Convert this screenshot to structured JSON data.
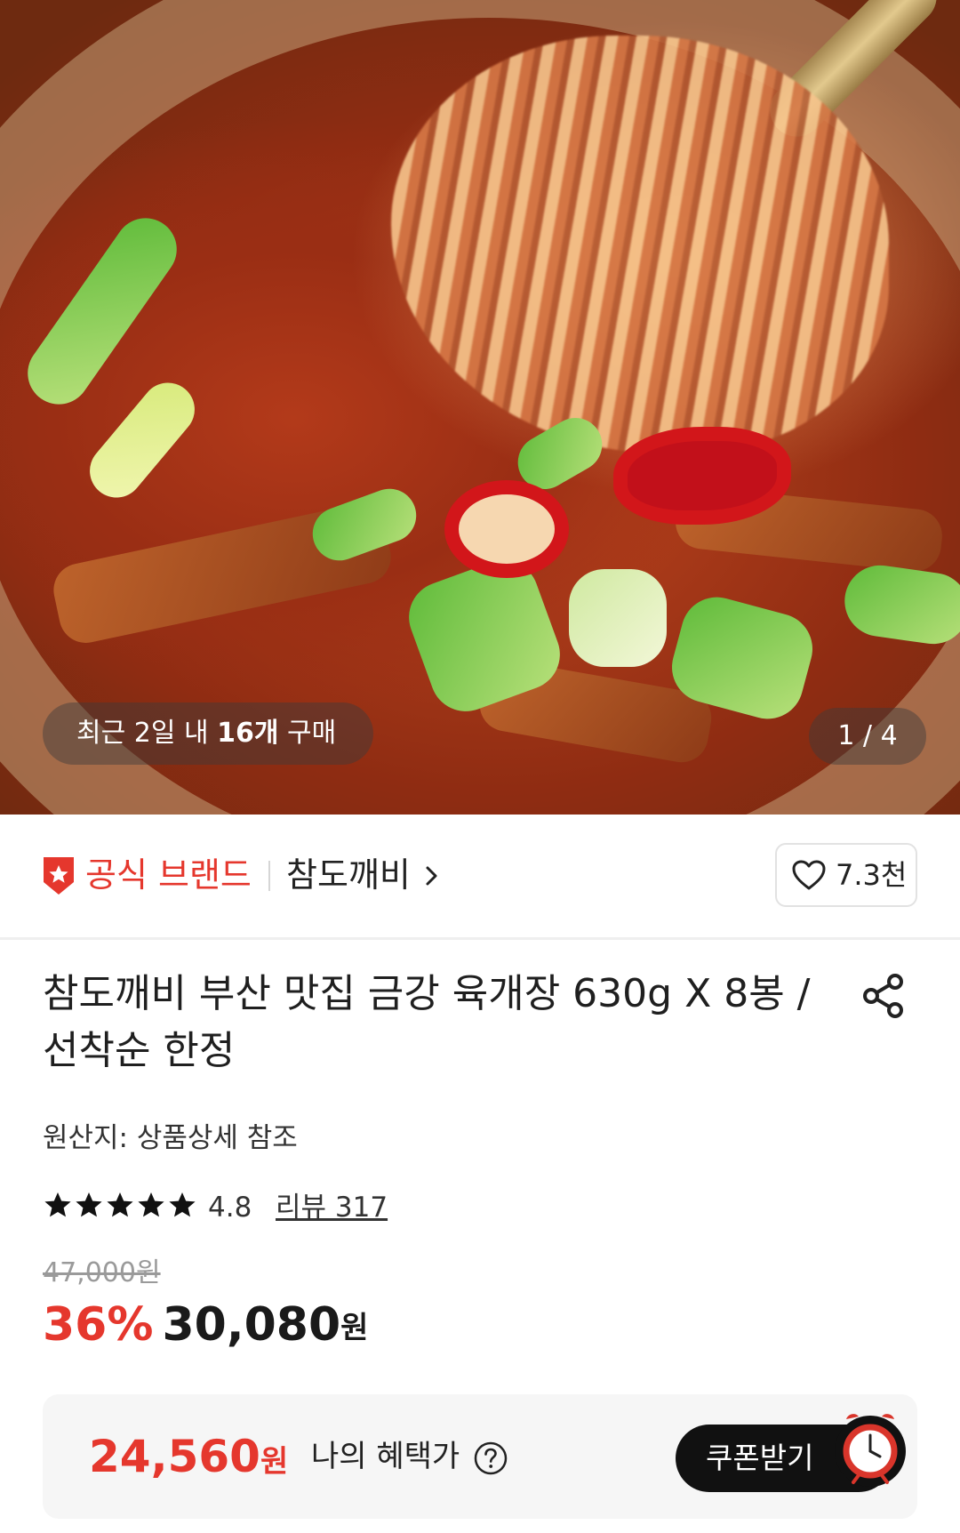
{
  "hero": {
    "purchase_prefix": "최근 2일 내 ",
    "purchase_count": "16개",
    "purchase_suffix": " 구매",
    "image_counter": "1 / 4"
  },
  "brand": {
    "badge_label": "공식 브랜드",
    "name": "참도깨비",
    "like_count": "7.3천"
  },
  "product": {
    "title": "참도깨비 부산 맛집 금강 육개장 630g X 8봉 / 선착순 한정",
    "origin": "원산지: 상품상세 참조",
    "rating": {
      "stars": 5,
      "value": "4.8",
      "review_label": "리뷰 317"
    },
    "original_price": "47,000원",
    "discount": "36%",
    "sale_price": "30,080",
    "sale_unit": "원"
  },
  "benefit": {
    "amount": "24,560",
    "unit": "원",
    "label": "나의 혜택가",
    "coupon_button": "쿠폰받기"
  },
  "colors": {
    "accent_red": "#e5372d",
    "button_dark": "#111111"
  }
}
